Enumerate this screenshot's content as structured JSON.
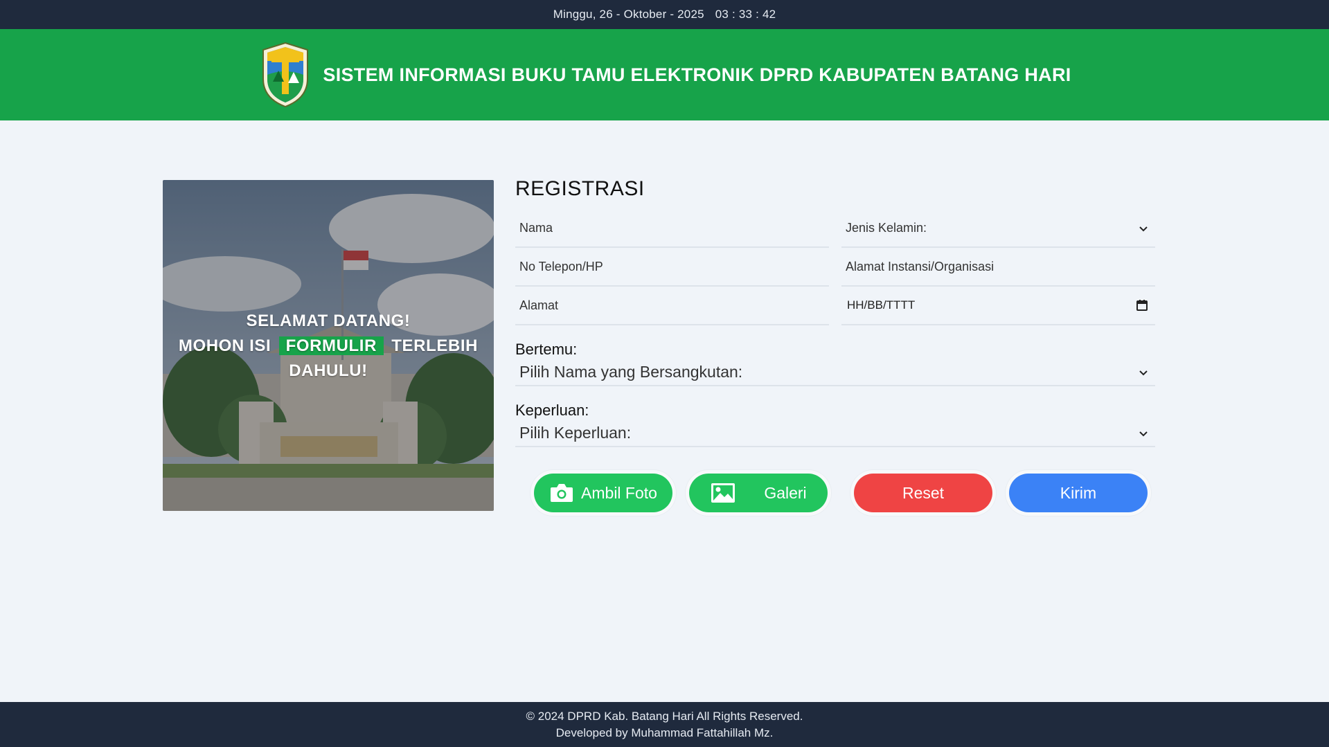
{
  "topbar": {
    "date": "Minggu, 26 - Oktober - 2025",
    "time": "03 : 33 : 42"
  },
  "header": {
    "title": "SISTEM INFORMASI BUKU TAMU ELEKTRONIK DPRD KABUPATEN BATANG HARI",
    "logo_icon": "regency-crest-icon"
  },
  "hero": {
    "line1": "SELAMAT DATANG!",
    "line2_pre": "MOHON ISI",
    "line2_highlight": "FORMULIR",
    "line2_post": "TERLEBIH",
    "line3": "DAHULU!"
  },
  "form": {
    "title": "REGISTRASI",
    "nama_placeholder": "Nama",
    "jenis_kelamin_value": "Jenis Kelamin:",
    "telepon_placeholder": "No Telepon/HP",
    "instansi_placeholder": "Alamat Instansi/Organisasi",
    "alamat_placeholder": "Alamat",
    "date_placeholder": "HH/BB/TTTT",
    "bertemu_label": "Bertemu:",
    "bertemu_value": "Pilih Nama yang Bersangkutan:",
    "keperluan_label": "Keperluan:",
    "keperluan_value": "Pilih Keperluan:"
  },
  "actions": {
    "ambil_foto": "Ambil Foto",
    "galeri": "Galeri",
    "reset": "Reset",
    "kirim": "Kirim"
  },
  "footer": {
    "copyright": "© 2024 DPRD Kab. Batang Hari All Rights Reserved.",
    "developer": "Developed by Muhammad Fattahillah Mz."
  },
  "colors": {
    "header_green": "#17a34a",
    "dark_bar": "#1f2a3d",
    "button_green": "#22c55e",
    "button_red": "#ef4444",
    "button_blue": "#3b82f6"
  }
}
